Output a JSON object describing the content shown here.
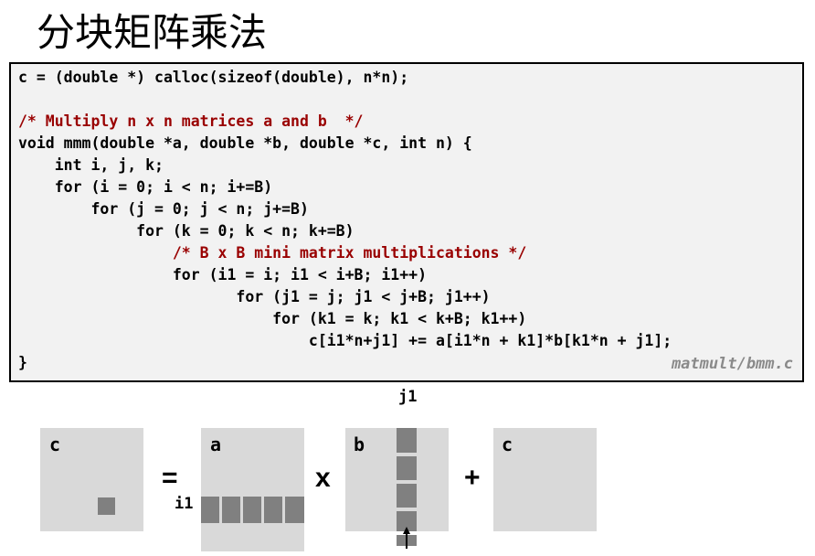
{
  "title": "分块矩阵乘法",
  "code": {
    "lines": [
      "c = (double *) calloc(sizeof(double), n*n);",
      "",
      "/* Multiply n x n matrices a and b  */",
      "void mmm(double *a, double *b, double *c, int n) {",
      "    int i, j, k;",
      "    for (i = 0; i < n; i+=B)",
      "        for (j = 0; j < n; j+=B)",
      "             for (k = 0; k < n; k+=B)",
      "                 /* B x B mini matrix multiplications */",
      "                 for (i1 = i; i1 < i+B; i1++)",
      "                        for (j1 = j; j1 < j+B; j1++)",
      "                            for (k1 = k; k1 < k+B; k1++)",
      "                                c[i1*n+j1] += a[i1*n + k1]*b[k1*n + j1];",
      "}"
    ],
    "filename": "matmult/bmm.c"
  },
  "diagram": {
    "labels": {
      "c_left": "c",
      "a": "a",
      "b": "b",
      "c_right": "c",
      "j1": "j1",
      "i1": "i1"
    },
    "operators": {
      "equals": "=",
      "times": "x",
      "plus": "+"
    }
  }
}
